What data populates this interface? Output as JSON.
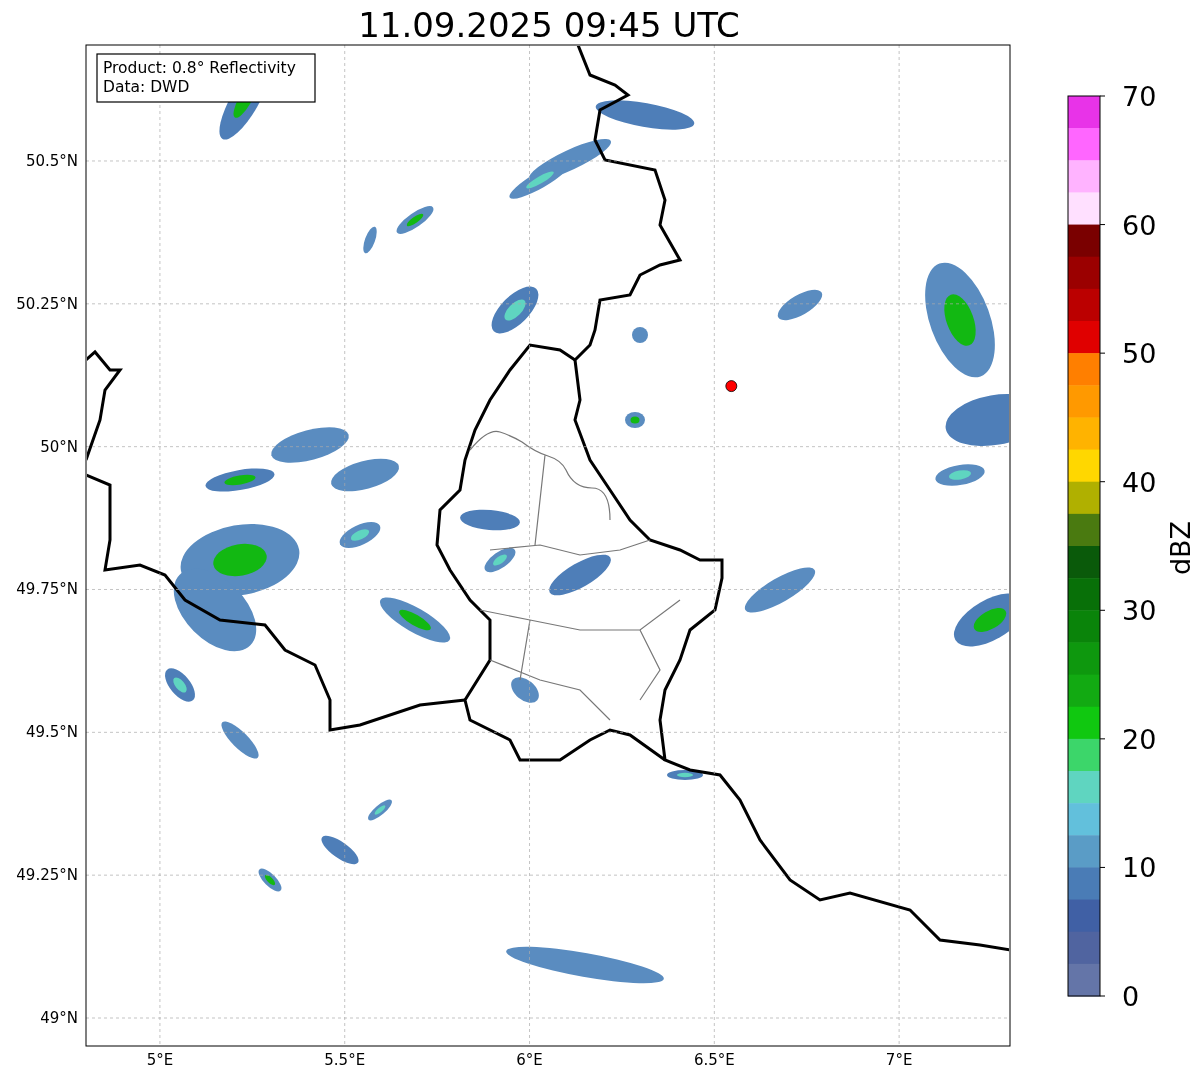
{
  "chart_data": {
    "type": "scatter",
    "title": "11.09.2025 09:45 UTC",
    "grid": true,
    "xlim": [
      4.8,
      7.3
    ],
    "ylim": [
      48.951,
      50.703
    ],
    "xticks": [
      {
        "value": 5,
        "label": "5°E"
      },
      {
        "value": 5.5,
        "label": "5.5°E"
      },
      {
        "value": 6,
        "label": "6°E"
      },
      {
        "value": 6.5,
        "label": "6.5°E"
      },
      {
        "value": 7,
        "label": "7°E"
      }
    ],
    "yticks": [
      {
        "value": 50.5,
        "label": "50.5°N"
      },
      {
        "value": 50.25,
        "label": "50.25°N"
      },
      {
        "value": 50,
        "label": "50°N"
      },
      {
        "value": 49.75,
        "label": "49.75°N"
      },
      {
        "value": 49.5,
        "label": "49.5°N"
      },
      {
        "value": 49.25,
        "label": "49.25°N"
      },
      {
        "value": 49,
        "label": "49°N"
      }
    ],
    "x": [
      6.546
    ],
    "series": [
      {
        "color": "#ff0000",
        "values": [
          50.106
        ]
      }
    ]
  },
  "info_box": [
    "Product: 0.8° Reflectivity",
    "Data: DWD"
  ],
  "colorbar": {
    "label": "dBZ",
    "ticks": [
      "70",
      "60",
      "50",
      "40",
      "30",
      "20",
      "10",
      "0"
    ],
    "levels": [
      {
        "color": "#e833e8"
      },
      {
        "color": "#ff66ff"
      },
      {
        "color": "#ffb3ff"
      },
      {
        "color": "#ffe0ff"
      },
      {
        "color": "#7a0000"
      },
      {
        "color": "#9b0000"
      },
      {
        "color": "#bb0000"
      },
      {
        "color": "#e00000"
      },
      {
        "color": "#ff7f00"
      },
      {
        "color": "#ff9900"
      },
      {
        "color": "#ffb300"
      },
      {
        "color": "#ffd700"
      },
      {
        "color": "#b0b000"
      },
      {
        "color": "#4a7a10"
      },
      {
        "color": "#0a5a0a"
      },
      {
        "color": "#087008"
      },
      {
        "color": "#0a840a"
      },
      {
        "color": "#0e980e"
      },
      {
        "color": "#12aa12"
      },
      {
        "color": "#10c810"
      },
      {
        "color": "#3cd66a"
      },
      {
        "color": "#5fd5c0"
      },
      {
        "color": "#62c0dc"
      },
      {
        "color": "#5a9cc6"
      },
      {
        "color": "#4a7cb6"
      },
      {
        "color": "#4060a5"
      },
      {
        "color": "#5064a0"
      },
      {
        "color": "#6475a8"
      }
    ]
  }
}
